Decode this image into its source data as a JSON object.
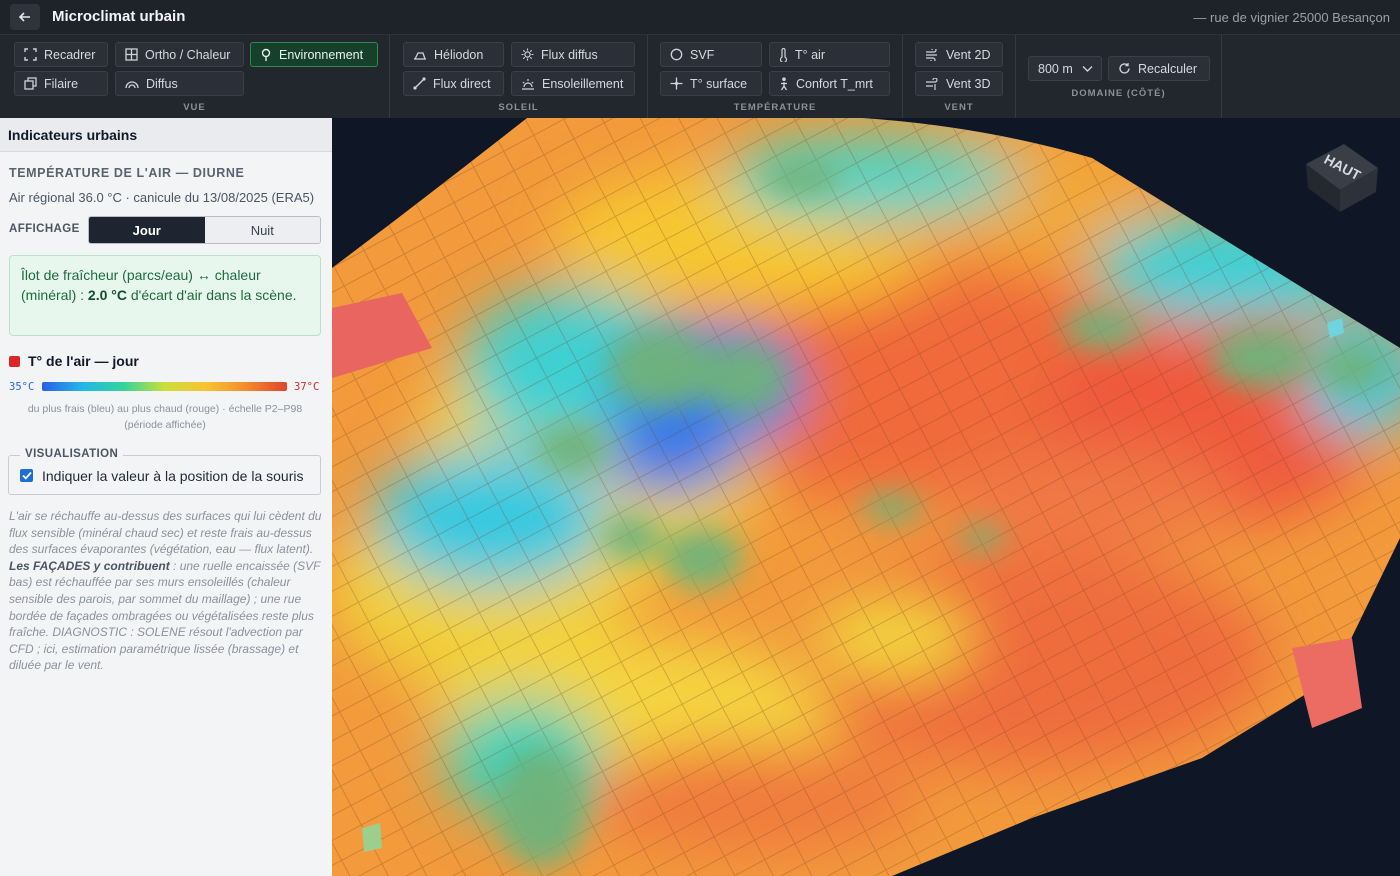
{
  "app": {
    "title": "Microclimat urbain",
    "address": "— rue de vignier 25000 Besançon"
  },
  "toolbar": {
    "vue": {
      "label": "VUE",
      "recadrer": "Recadrer",
      "ortho": "Ortho / Chaleur",
      "environnement": "Environnement",
      "filaire": "Filaire",
      "diffus": "Diffus"
    },
    "soleil": {
      "label": "SOLEIL",
      "heliodon": "Héliodon",
      "flux_diffus": "Flux diffus",
      "flux_direct": "Flux direct",
      "ensoleillement": "Ensoleillement"
    },
    "temperature": {
      "label": "TEMPÉRATURE",
      "svf": "SVF",
      "t_air": "T° air",
      "t_surface": "T° surface",
      "confort": "Confort T_mrt"
    },
    "vent": {
      "label": "VENT",
      "vent2d": "Vent 2D",
      "vent3d": "Vent 3D"
    },
    "domaine": {
      "label": "DOMAINE (CÔTÉ)",
      "value": "800 m",
      "recalculer": "Recalculer"
    }
  },
  "sidebar": {
    "header": "Indicateurs urbains",
    "section_title": "TEMPÉRATURE DE L'AIR — DIURNE",
    "subtitle": "Air régional 36.0 °C · canicule du 13/08/2025 (ERA5)",
    "affichage_label": "AFFICHAGE",
    "jour": "Jour",
    "nuit": "Nuit",
    "info_pre": "Îlot de fraîcheur (parcs/eau) ↔ chaleur (minéral) : ",
    "info_value": "2.0 °C",
    "info_post": " d'écart d'air dans la scène.",
    "legend_title": "T° de l'air — jour",
    "legend_min": "35°C",
    "legend_max": "37°C",
    "legend_note": "du plus frais (bleu) au plus chaud (rouge) · échelle P2–P98 (période affichée)",
    "visualisation_label": "VISUALISATION",
    "checkbox_label": "Indiquer la valeur à la position de la souris",
    "checkbox_checked": true,
    "desc_1": "L'air se réchauffe au-dessus des surfaces qui lui cèdent du flux sensible (minéral chaud sec) et reste frais au-dessus des surfaces évaporantes (végétation, eau — flux latent). ",
    "desc_bold": "Les FAÇADES y contribuent",
    "desc_2": " : une ruelle encaissée (SVF bas) est réchauffée par ses murs ensoleillés (chaleur sensible des parois, par sommet du maillage) ; une rue bordée de façades ombragées ou végétalisées reste plus fraîche. DIAGNOSTIC : SOLENE résout l'advection par CFD ; ici, estimation paramétrique lissée (brassage) et diluée par le vent."
  },
  "map": {
    "cube_label": "HAUT"
  },
  "colors": {
    "accent_green": "#2f8a4f",
    "cold": "#2a5ee8",
    "hot": "#e2412e",
    "tree": "#6fb27a"
  }
}
